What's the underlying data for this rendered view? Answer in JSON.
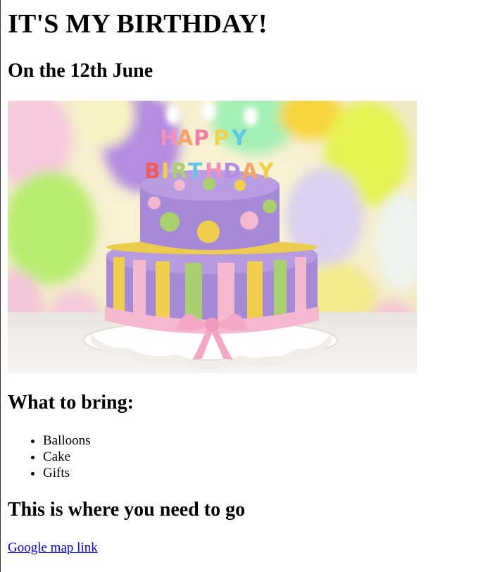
{
  "page": {
    "title": "IT'S MY BIRTHDAY!",
    "date_heading": "On the 12th June",
    "image": {
      "icon": "birthday-cake-image",
      "cake_text_line1": "HAPPY",
      "cake_text_line2": "BIRTHDAY"
    },
    "bring_heading": "What to bring:",
    "bring_items": [
      "Balloons",
      "Cake",
      "Gifts"
    ],
    "go_heading": "This is where you need to go",
    "map_link": "Google map link"
  },
  "colors": {
    "link": "#0000ee",
    "cake_purple": "#a68ad8",
    "cake_pink": "#f4b9cf",
    "cake_yellow": "#f2cf4b",
    "cake_green": "#a9cf6e"
  }
}
